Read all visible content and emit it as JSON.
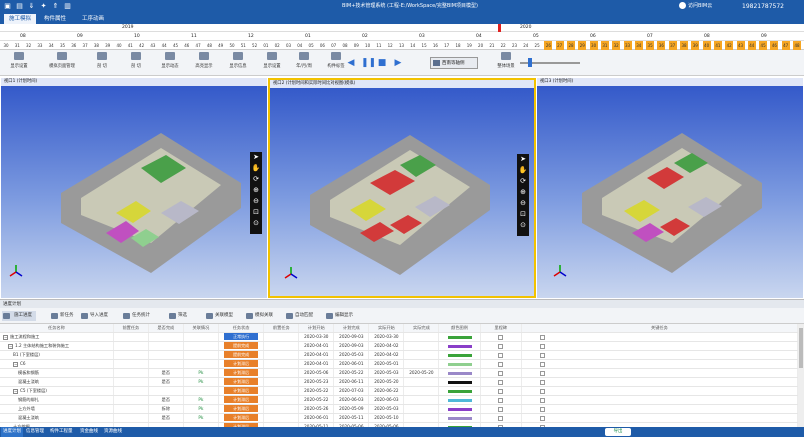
{
  "app": {
    "title": "BIM+技术管理系统 (工程-E:/WorkSpace/完整BIM项目模型)",
    "login_label": "访问BIM云",
    "phone": "19821787572"
  },
  "quick_access": [
    "file-icon",
    "save-icon",
    "download-icon",
    "pin-icon",
    "upload-icon",
    "export-icon"
  ],
  "menu": {
    "tabs": [
      "施工模拟",
      "构件属性",
      "工序动画"
    ]
  },
  "timeline": {
    "years": [
      "2019",
      "2020"
    ],
    "months": [
      "08",
      "09",
      "10",
      "11",
      "12",
      "01",
      "02",
      "03",
      "04",
      "05",
      "06",
      "07",
      "08",
      "09"
    ],
    "weeks": [
      "30",
      "31",
      "32",
      "33",
      "34",
      "35",
      "36",
      "37",
      "38",
      "39",
      "40",
      "41",
      "42",
      "43",
      "44",
      "45",
      "46",
      "47",
      "48",
      "49",
      "50",
      "51",
      "52",
      "01",
      "02",
      "03",
      "04",
      "05",
      "06",
      "07",
      "08",
      "09",
      "10",
      "11",
      "12",
      "13",
      "14",
      "15",
      "16",
      "17",
      "18",
      "19",
      "20",
      "21",
      "22",
      "23",
      "24",
      "25",
      "26",
      "27",
      "28",
      "29",
      "30",
      "31",
      "32",
      "33",
      "34",
      "35",
      "36",
      "37",
      "38",
      "39",
      "40",
      "41",
      "42",
      "43",
      "44",
      "45",
      "46",
      "47",
      "48"
    ]
  },
  "toolbar": {
    "buttons": [
      "显示设置",
      "模拟页面管理",
      "剖 切",
      "剖 切",
      "显示动态",
      "高亮显示",
      "显示信息",
      "显示设置",
      "年/月/周",
      "构件标签"
    ],
    "view_select": "西南等轴侧",
    "extra_button": "整体场景"
  },
  "viewports": [
    {
      "title": "视口1 (计划时间)"
    },
    {
      "title": "视口2 (计划时间和实际时间比对视图(模拟)"
    },
    {
      "title": "视口3 (计划时间)"
    }
  ],
  "panel": {
    "title": "进度计划",
    "tools": [
      "施工进度",
      "新任务",
      "导入进度",
      "任务统计",
      "筛选",
      "关联模型",
      "模拟关联",
      "自动匹配",
      "编辑显示"
    ]
  },
  "table": {
    "headers": [
      "任务名称",
      "前置任务",
      "是否完成",
      "关联情况",
      "任务状态",
      "前置任务",
      "计划开始",
      "计划完成",
      "实际开始",
      "实际完成",
      "颜色图例",
      "里程碑",
      "关键任务"
    ],
    "rows": [
      {
        "name": "施工流程和施工",
        "finish": "",
        "link": "",
        "status": "正常执行",
        "scolor": "#2f6fd0",
        "ps": "2020-03-30",
        "pe": "2020-09-03",
        "as": "2020-03-30",
        "ae": "",
        "legend": "#3aa33a"
      },
      {
        "name": "1.2 主体结构施工和装饰施工",
        "finish": "",
        "link": "",
        "status": "提前完成",
        "scolor": "#e8802a",
        "ps": "2020-04-01",
        "pe": "2020-09-03",
        "as": "2020-04-02",
        "ae": "",
        "legend": "#8a3ec8"
      },
      {
        "name": "B1 (下室楼层)",
        "finish": "",
        "link": "",
        "status": "提前完成",
        "scolor": "#e8802a",
        "ps": "2020-04-01",
        "pe": "2020-05-03",
        "as": "2020-04-02",
        "ae": "",
        "legend": "#3aa33a"
      },
      {
        "name": "C6",
        "finish": "",
        "link": "",
        "status": "计划滞后",
        "scolor": "#e8802a",
        "ps": "2020-04-01",
        "pe": "2020-06-01",
        "as": "2020-05-01",
        "ae": "",
        "legend": "#8fcf8f"
      },
      {
        "name": "模板和钢筋",
        "finish": "是否",
        "link": "Pk",
        "status": "计划滞后",
        "scolor": "#e8802a",
        "ps": "2020-05-06",
        "pe": "2020-05-22",
        "as": "2020-05-03",
        "ae": "2020-05-20",
        "legend": "#9a88c8"
      },
      {
        "name": "混凝土浇筑",
        "finish": "是否",
        "link": "Pk",
        "status": "计划滞后",
        "scolor": "#e8802a",
        "ps": "2020-05-23",
        "pe": "2020-06-11",
        "as": "2020-05-20",
        "ae": "",
        "legend": "#111111"
      },
      {
        "name": "C5 (下室楼层)",
        "finish": "",
        "link": "",
        "status": "计划滞后",
        "scolor": "#e8802a",
        "ps": "2020-05-22",
        "pe": "2020-07-03",
        "as": "2020-06-22",
        "ae": "",
        "legend": "#3aa33a"
      },
      {
        "name": "钢筋的绑扎",
        "finish": "是否",
        "link": "Pk",
        "status": "计划滞后",
        "scolor": "#e8802a",
        "ps": "2020-05-22",
        "pe": "2020-06-03",
        "as": "2020-06-03",
        "ae": "",
        "legend": "#4fb8d8"
      },
      {
        "name": "上方外墙",
        "finish": "拆除",
        "link": "Pk",
        "status": "计划滞后",
        "scolor": "#e8802a",
        "ps": "2020-05-26",
        "pe": "2020-05-09",
        "as": "2020-05-03",
        "ae": "",
        "legend": "#8a3ec8"
      },
      {
        "name": "混凝土浇筑",
        "finish": "是否",
        "link": "Pk",
        "status": "计划滞后",
        "scolor": "#e8802a",
        "ps": "2020-06-01",
        "pe": "2020-05-11",
        "as": "2020-05-10",
        "ae": "",
        "legend": "#9a88c8"
      },
      {
        "name": "土方挖掘",
        "finish": "",
        "link": "",
        "status": "计划滞后",
        "scolor": "#e8802a",
        "ps": "2020-05-11",
        "pe": "2020-05-06",
        "as": "2020-05-06",
        "ae": "",
        "legend": "#3aa33a"
      }
    ]
  },
  "statusbar": {
    "items": [
      "进度计划",
      "信息管理",
      "构件工程量",
      "资金曲线",
      "资源曲线"
    ],
    "badge": "导出"
  }
}
